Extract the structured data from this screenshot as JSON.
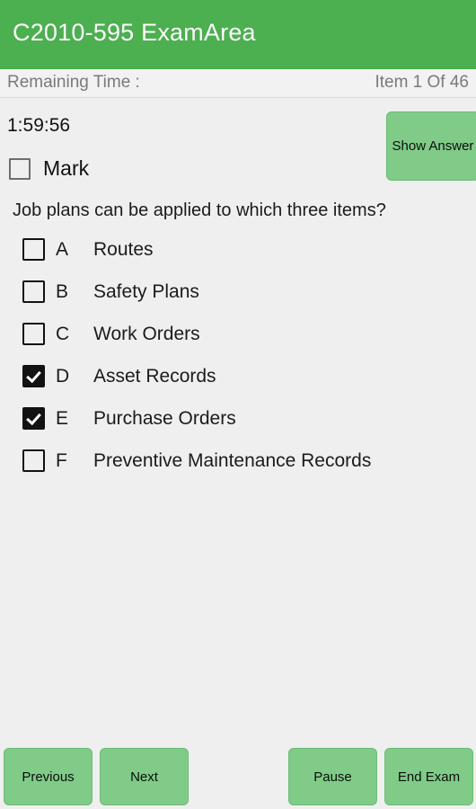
{
  "appbar": {
    "title": "C2010-595 ExamArea"
  },
  "status": {
    "remaining_time_label": "Remaining Time :",
    "item_counter": "Item 1 Of 46"
  },
  "timer": {
    "value": "1:59:56"
  },
  "mark": {
    "label": "Mark",
    "checked": false
  },
  "show_answer": {
    "label": "Show Answer"
  },
  "question": {
    "text": "Job plans can be applied to which three items?",
    "options": [
      {
        "letter": "A",
        "text": "Routes",
        "checked": false
      },
      {
        "letter": "B",
        "text": "Safety Plans",
        "checked": false
      },
      {
        "letter": "C",
        "text": "Work Orders",
        "checked": false
      },
      {
        "letter": "D",
        "text": "Asset Records",
        "checked": true
      },
      {
        "letter": "E",
        "text": "Purchase Orders",
        "checked": true
      },
      {
        "letter": "F",
        "text": "Preventive Maintenance Records",
        "checked": false
      }
    ]
  },
  "bottom_bar": {
    "previous_label": "Previous",
    "next_label": "Next",
    "pause_label": "Pause",
    "end_exam_label": "End Exam"
  },
  "colors": {
    "appbar_green": "#4caf50",
    "button_green": "#7fcb87",
    "page_background": "#efefef",
    "muted_text": "#7a7a7a"
  }
}
